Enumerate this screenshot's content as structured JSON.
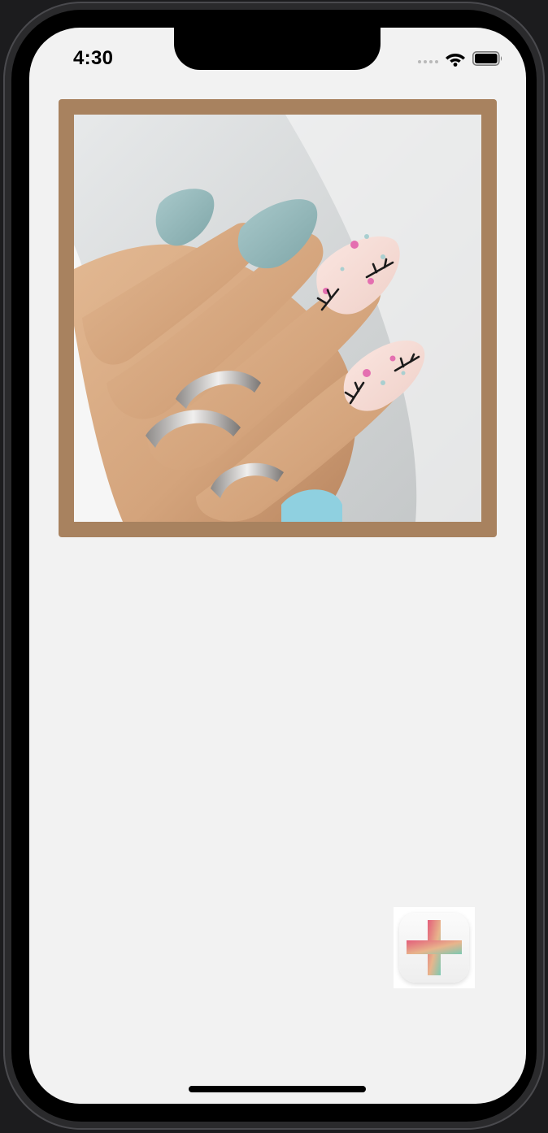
{
  "status_bar": {
    "time": "4:30",
    "icons": [
      "signal-dots-icon",
      "wifi-icon",
      "battery-icon"
    ]
  },
  "main": {
    "image_frame_color": "#a8825f",
    "image": {
      "subject": "manicured-nails-photo",
      "palette": [
        "#96b9bb",
        "#f6dcd6",
        "#d8ab85",
        "#e46fb0"
      ]
    },
    "add_button": {
      "icon": "plus-icon",
      "gradient": [
        "#e35d7a",
        "#e8b58c",
        "#7cc9b3"
      ]
    }
  },
  "colors": {
    "screen_background": "#f2f2f2",
    "device": "#000000"
  }
}
